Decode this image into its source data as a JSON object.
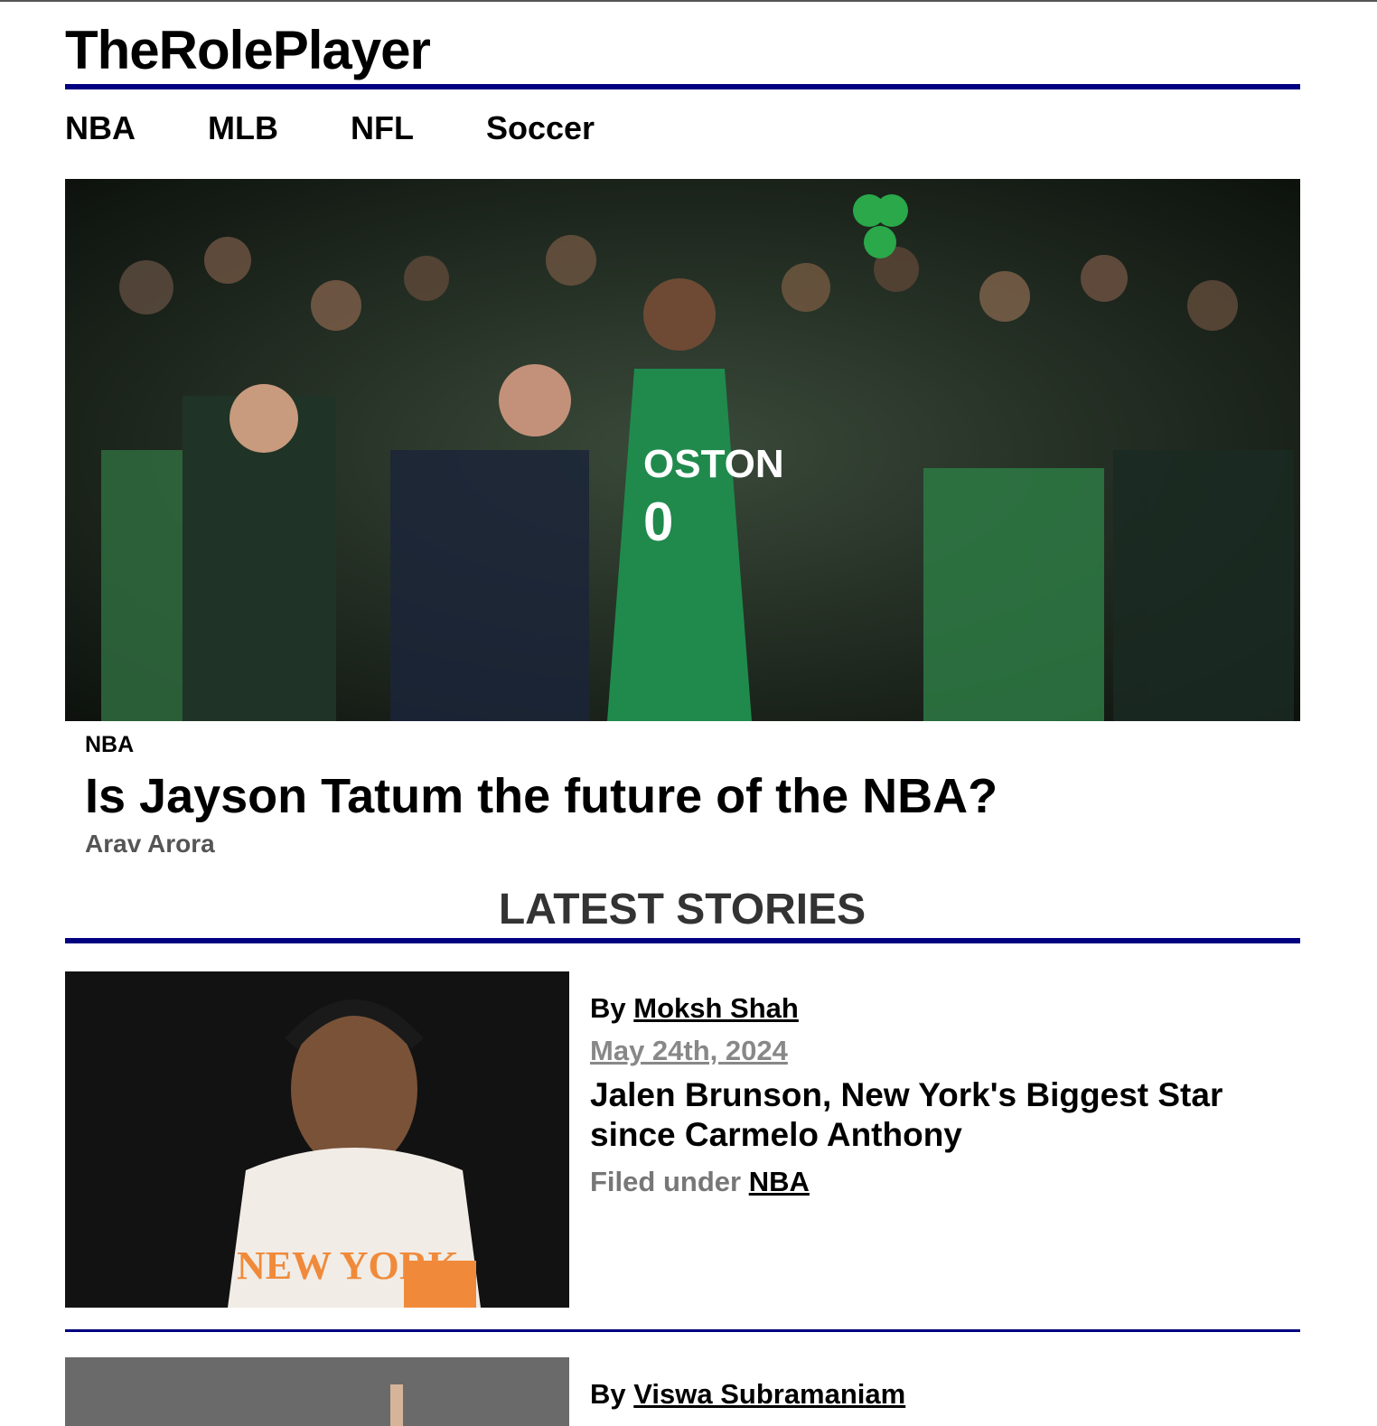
{
  "site": {
    "title": "TheRolePlayer"
  },
  "nav": {
    "items": [
      {
        "label": "NBA"
      },
      {
        "label": "MLB"
      },
      {
        "label": "NFL"
      },
      {
        "label": "Soccer"
      }
    ]
  },
  "hero": {
    "tag": "NBA",
    "title": "Is Jayson Tatum the future of the NBA?",
    "author": "Arav Arora",
    "image": "celtics-player-celebrating-crowd-photo"
  },
  "latest": {
    "heading": "LATEST STORIES",
    "stories": [
      {
        "by_prefix": "By",
        "author": "Moksh Shah",
        "date": "May 24th, 2024",
        "title": "Jalen Brunson, New York's Biggest Star since Carmelo Anthony",
        "filed_prefix": "Filed under",
        "category": "NBA",
        "image": "knicks-player-photo"
      },
      {
        "by_prefix": "By",
        "author": "Viswa Subramaniam",
        "image": "basketball-player-photo"
      }
    ]
  },
  "colors": {
    "accent_rule": "#000080",
    "muted_text": "#888888"
  }
}
